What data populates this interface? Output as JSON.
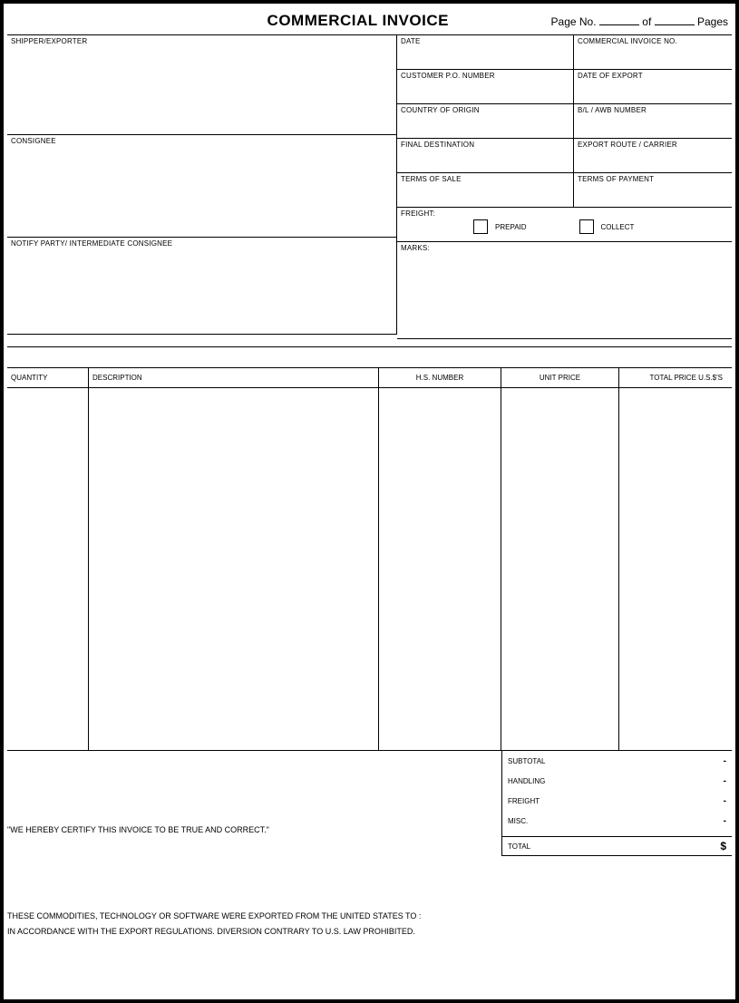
{
  "header": {
    "title": "COMMERCIAL INVOICE",
    "page_no_label": "Page No.",
    "of_label": "of",
    "pages_label": "Pages"
  },
  "left": {
    "shipper_label": "SHIPPER/EXPORTER",
    "consignee_label": "CONSIGNEE",
    "notify_label": "NOTIFY PARTY/ INTERMEDIATE CONSIGNEE"
  },
  "right": {
    "date_label": "DATE",
    "inv_no_label": "COMMERCIAL INVOICE NO.",
    "cust_po_label": "CUSTOMER P.O. NUMBER",
    "export_date_label": "DATE OF EXPORT",
    "origin_label": "COUNTRY OF ORIGIN",
    "bl_awb_label": "B/L / AWB NUMBER",
    "destination_label": "FINAL DESTINATION",
    "route_label": "EXPORT ROUTE / CARRIER",
    "terms_sale_label": "TERMS OF SALE",
    "terms_payment_label": "TERMS OF PAYMENT",
    "freight_label": "FREIGHT:",
    "prepaid_label": "PREPAID",
    "collect_label": "COLLECT",
    "marks_label": "MARKS:"
  },
  "table": {
    "qty": "QUANTITY",
    "desc": "DESCRIPTION",
    "hs": "H.S. NUMBER",
    "unit": "UNIT PRICE",
    "total": "TOTAL PRICE U.S.$'S"
  },
  "totals": {
    "subtotal": "SUBTOTAL",
    "handling": "HANDLING",
    "freight": "FREIGHT",
    "misc": "MISC.",
    "total": "TOTAL",
    "dash": "-",
    "dollar": "$"
  },
  "cert": "\"WE HEREBY CERTIFY THIS INVOICE TO BE TRUE AND CORRECT.\"",
  "notice1": "THESE COMMODITIES, TECHNOLOGY OR SOFTWARE WERE EXPORTED FROM THE UNITED STATES TO :",
  "notice2": "IN ACCORDANCE WITH THE EXPORT REGULATIONS.  DIVERSION CONTRARY TO U.S. LAW PROHIBITED."
}
